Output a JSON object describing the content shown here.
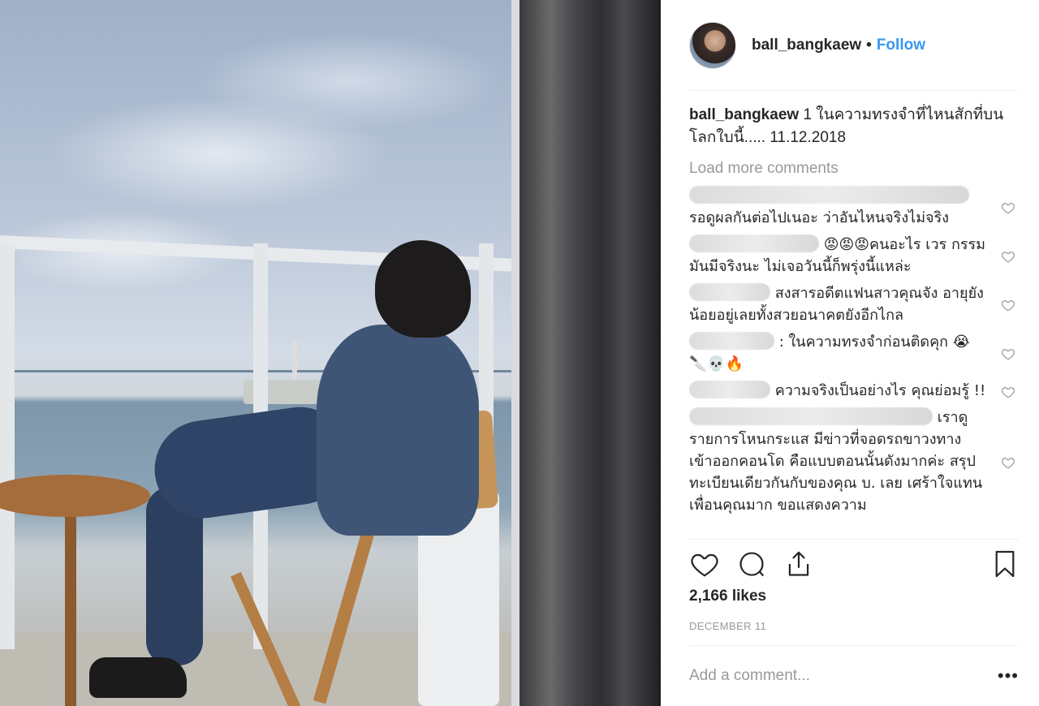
{
  "post": {
    "username": "ball_bangkaew",
    "separator": "•",
    "follow_label": "Follow",
    "caption_user": "ball_bangkaew",
    "caption_text": "1 ในความทรงจำที่ไหนสักที่บนโลกใบนี้..... 11.12.2018",
    "load_more": "Load more comments",
    "likes": "2,166 likes",
    "date": "DECEMBER 11",
    "add_comment_placeholder": "Add a comment...",
    "more_label": "•••"
  },
  "comments": [
    {
      "name_redacted": true,
      "text": "รอดูผลกันต่อไปเนอะ ว่าอันไหนจริงไม่จริง"
    },
    {
      "name_redacted": true,
      "text": "😡😡😡คนอะไร เวร กรรมมันมีจริงนะ ไม่เจอวันนี้ก็พรุ่งนี้แหล่ะ"
    },
    {
      "name_redacted": true,
      "text": "สงสารอดีตแฟนสาวคุณจัง อายุยังน้อยอยู่เลยทั้งสวยอนาคตยังอีกไกล"
    },
    {
      "name_redacted": true,
      "text": ": ในความทรงจำก่อนติดคุก 😭🔪💀🔥"
    },
    {
      "name_redacted": true,
      "text": "ความจริงเป็นอย่างไร คุณย่อมรู้ !!"
    },
    {
      "name_redacted": true,
      "text": "เราดู รายการโหนกระแส มีข่าวที่จอดรถขาวงทาง เข้าออกคอนโด คือแบบตอนนั้นดังมากค่ะ สรุปทะเบียนเดียวกันกับของคุณ บ. เลย เศร้าใจแทนเพื่อนคุณมาก ขอแสดงความ"
    }
  ],
  "icons": {
    "like": "heart-icon",
    "comment": "comment-icon",
    "share": "share-icon",
    "save": "bookmark-icon",
    "comment_like": "heart-icon"
  },
  "colors": {
    "follow": "#3897f0",
    "muted": "#999999",
    "text": "#262626"
  }
}
